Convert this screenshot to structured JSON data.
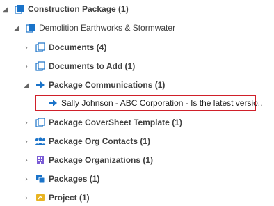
{
  "tree": {
    "root": {
      "label": "Construction Package (1)",
      "icon": "pages-icon",
      "expanded": true
    },
    "child": {
      "label": "Demolition Earthworks & Stormwater",
      "icon": "pages-icon",
      "expanded": true
    },
    "items": [
      {
        "label": "Documents (4)",
        "icon": "pages-icon",
        "expanded": false
      },
      {
        "label": "Documents to Add (1)",
        "icon": "pages-icon",
        "expanded": false
      },
      {
        "label": "Package Communications (1)",
        "icon": "arrow-icon",
        "expanded": true
      },
      {
        "label": "Package CoverSheet Template (1)",
        "icon": "pages-icon",
        "expanded": false
      },
      {
        "label": "Package Org Contacts (1)",
        "icon": "people-icon",
        "expanded": false
      },
      {
        "label": "Package Organizations (1)",
        "icon": "building-icon",
        "expanded": false
      },
      {
        "label": "Packages (1)",
        "icon": "packages-icon",
        "expanded": false
      },
      {
        "label": "Project (1)",
        "icon": "project-icon",
        "expanded": false
      }
    ],
    "communication": {
      "label": "Sally Johnson - ABC Corporation - Is the latest versio..",
      "icon": "arrow-icon"
    }
  },
  "colors": {
    "selection_border": "#d0202a",
    "icon_blue": "#1a73c9"
  }
}
